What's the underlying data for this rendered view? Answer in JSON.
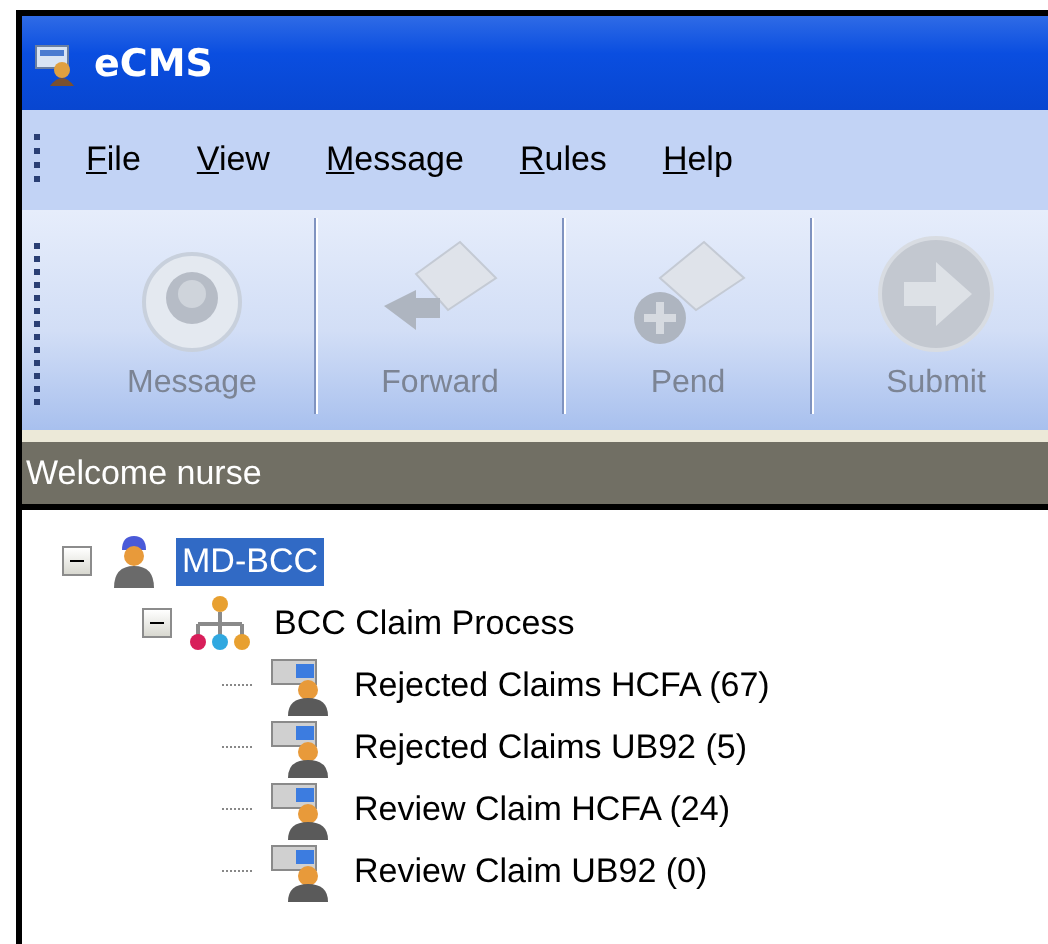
{
  "window": {
    "title": "eCMS"
  },
  "menu": [
    {
      "label": "File"
    },
    {
      "label": "View"
    },
    {
      "label": "Message"
    },
    {
      "label": "Rules"
    },
    {
      "label": "Help"
    }
  ],
  "toolbar": [
    {
      "label": "Message",
      "kind": "record",
      "disabled": true
    },
    {
      "label": "Forward",
      "kind": "forward",
      "disabled": true
    },
    {
      "label": "Pend",
      "kind": "pend",
      "disabled": true
    },
    {
      "label": "Submit",
      "kind": "submit",
      "disabled": true
    }
  ],
  "status": "Welcome nurse",
  "tree": [
    {
      "label": "MD-BCC",
      "kind": "user",
      "selected": true,
      "expanded": true,
      "children": [
        {
          "label": "BCC Claim Process",
          "kind": "process",
          "selected": false,
          "expanded": true,
          "children": [
            {
              "label": "Rejected Claims HCFA (67)",
              "kind": "queue",
              "selected": false
            },
            {
              "label": "Rejected Claims UB92 (5)",
              "kind": "queue",
              "selected": false
            },
            {
              "label": "Review Claim HCFA (24)",
              "kind": "queue",
              "selected": false
            },
            {
              "label": "Review Claim UB92 (0)",
              "kind": "queue",
              "selected": false
            }
          ]
        }
      ]
    }
  ]
}
